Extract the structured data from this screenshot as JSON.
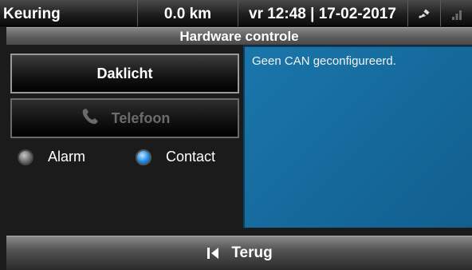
{
  "statusbar": {
    "mode": "Keuring",
    "distance": "0.0 km",
    "datetime": "vr 12:48 | 17-02-2017",
    "satellite_icon": "satellite-icon",
    "signal_icon": "signal-strength-icon"
  },
  "title": "Hardware controle",
  "buttons": {
    "daklicht": "Daklicht",
    "telefoon": "Telefoon"
  },
  "radios": [
    {
      "label": "Alarm",
      "active": false
    },
    {
      "label": "Contact",
      "active": true
    }
  ],
  "info": {
    "message": "Geen CAN geconfigureerd."
  },
  "footer": {
    "back_label": "Terug"
  },
  "colors": {
    "accent_blue": "#1a76ab",
    "radio_active": "#1e8be8",
    "disabled_text": "#6b6b6b"
  }
}
